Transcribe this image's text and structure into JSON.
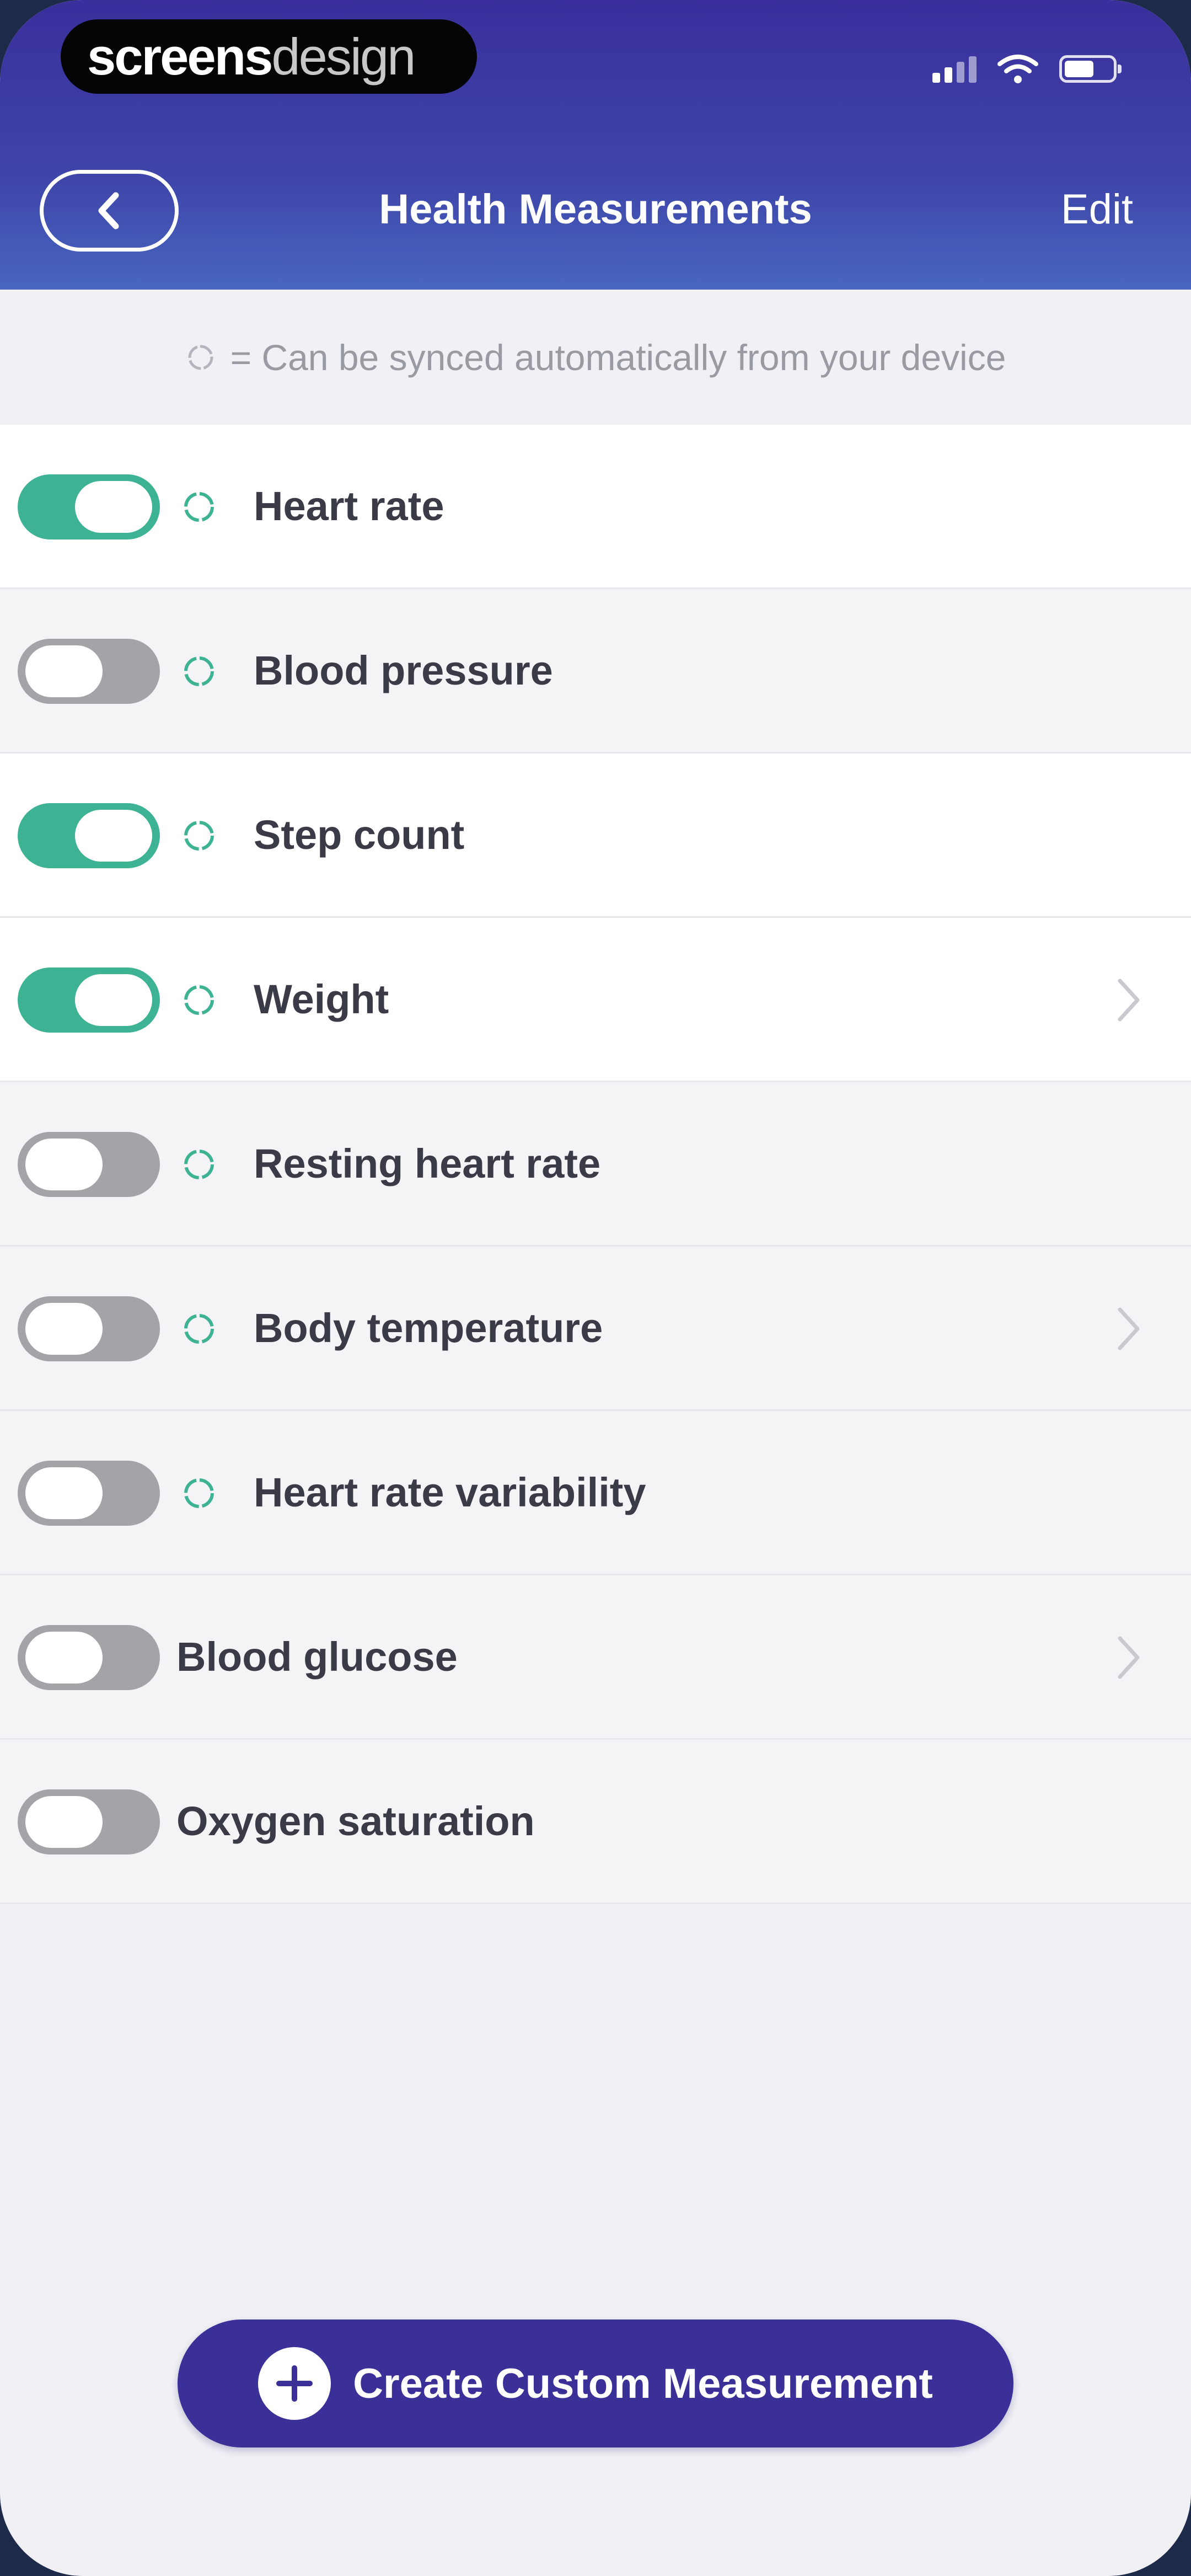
{
  "status_bar": {
    "brand_part1": "screens",
    "brand_part2": "design"
  },
  "nav": {
    "title": "Health Measurements",
    "edit_label": "Edit"
  },
  "legend": {
    "text": "= Can be synced automatically from your device"
  },
  "measurements": [
    {
      "label": "Heart rate",
      "enabled": true,
      "syncable": true,
      "has_detail": false
    },
    {
      "label": "Blood pressure",
      "enabled": false,
      "syncable": true,
      "has_detail": false
    },
    {
      "label": "Step count",
      "enabled": true,
      "syncable": true,
      "has_detail": false
    },
    {
      "label": "Weight",
      "enabled": true,
      "syncable": true,
      "has_detail": true
    },
    {
      "label": "Resting heart rate",
      "enabled": false,
      "syncable": true,
      "has_detail": false
    },
    {
      "label": "Body temperature",
      "enabled": false,
      "syncable": true,
      "has_detail": true
    },
    {
      "label": "Heart rate variability",
      "enabled": false,
      "syncable": true,
      "has_detail": false
    },
    {
      "label": "Blood glucose",
      "enabled": false,
      "syncable": false,
      "has_detail": true
    },
    {
      "label": "Oxygen saturation",
      "enabled": false,
      "syncable": false,
      "has_detail": false
    }
  ],
  "cta": {
    "label": "Create Custom Measurement",
    "icon": "plus-circle-icon"
  },
  "colors": {
    "header": "#3e44a8",
    "toggle_on": "#3db394",
    "toggle_off": "#a3a3a8",
    "cta": "#3b2f98"
  }
}
